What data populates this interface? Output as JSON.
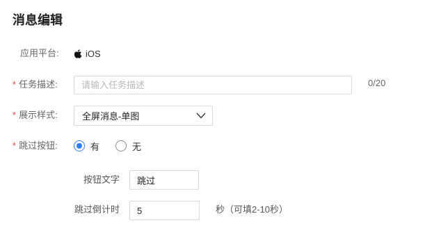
{
  "page": {
    "title": "消息编辑"
  },
  "form": {
    "platform": {
      "label": "应用平台:",
      "icon": "apple-icon",
      "value": "iOS"
    },
    "task_desc": {
      "required_mark": "*",
      "label": "任务描述:",
      "placeholder": "请输入任务描述",
      "value": "",
      "counter": "0/20"
    },
    "display_style": {
      "required_mark": "*",
      "label": "展示样式:",
      "selected": "全屏消息-单图",
      "icon": "chevron-down-icon"
    },
    "skip_button": {
      "required_mark": "*",
      "label": "跳过按钮:",
      "options": [
        {
          "label": "有",
          "checked": true
        },
        {
          "label": "无",
          "checked": false
        }
      ]
    },
    "button_text": {
      "label": "按钮文字",
      "value": "跳过"
    },
    "skip_countdown": {
      "label": "跳过倒计时",
      "value": "5",
      "hint": "秒（可填2-10秒）"
    }
  },
  "colors": {
    "accent": "#2d7ff9",
    "required": "#e64c4c",
    "border": "#d9d9d9"
  }
}
